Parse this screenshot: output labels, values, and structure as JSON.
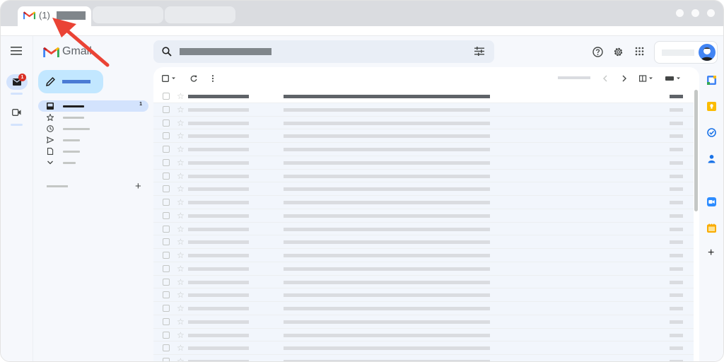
{
  "browser": {
    "tab_count": "(1)"
  },
  "app": {
    "name": "Gmail"
  },
  "nav": {
    "inbox_count": "1"
  },
  "rail": {
    "mail_badge": "1"
  },
  "labels": {
    "add": "+"
  },
  "side_panel": {
    "add": "+"
  },
  "colors": {
    "accent_red": "#ea4335",
    "compose_bg": "#c2e7ff",
    "selected_nav_bg": "#d3e3fd",
    "unread_row_bg": "#ffffff",
    "read_row_bg": "#f2f6fc"
  },
  "icons": [
    "gmail-logo-icon",
    "menu-icon",
    "search-icon",
    "tune-icon",
    "help-icon",
    "settings-icon",
    "apps-icon",
    "pencil-icon",
    "inbox-icon",
    "star-icon",
    "clock-icon",
    "send-icon",
    "draft-icon",
    "chevron-down-icon",
    "refresh-icon",
    "more-icon",
    "chevron-left-icon",
    "chevron-right-icon",
    "calendar-icon",
    "keep-icon",
    "tasks-icon",
    "contacts-icon",
    "zoom-icon",
    "notes-icon",
    "plus-icon"
  ]
}
